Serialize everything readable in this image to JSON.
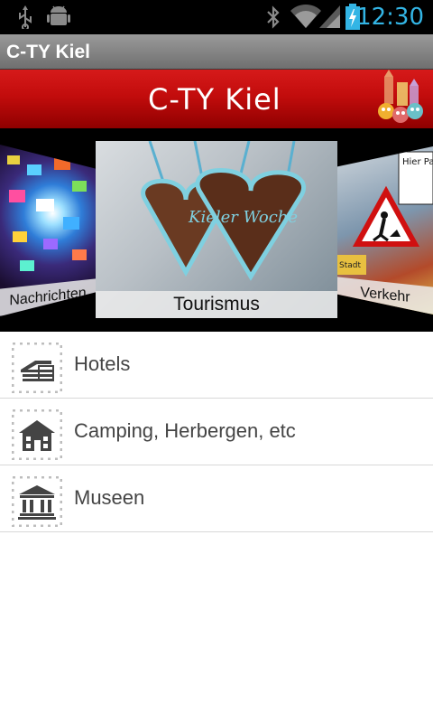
{
  "statusbar": {
    "icons": [
      "usb-icon",
      "android-debug-icon",
      "bluetooth-icon",
      "wifi-icon",
      "signal-icon",
      "battery-charging-icon"
    ],
    "time": "12:30"
  },
  "actionbar": {
    "title": "C-TY Kiel"
  },
  "banner": {
    "logo_text": "C-TY Kiel"
  },
  "carousel": {
    "panels": [
      {
        "label": "Nachrichten"
      },
      {
        "label": "Tourismus",
        "heart_text": "Kieler Woche"
      },
      {
        "label": "Verkehr",
        "sign_text": "Hier Parksch löse",
        "sign_text_small": "Stadt"
      }
    ]
  },
  "list": {
    "items": [
      {
        "label": "Hotels",
        "icon": "hotel-icon"
      },
      {
        "label": "Camping, Herbergen, etc",
        "icon": "house-icon"
      },
      {
        "label": "Museen",
        "icon": "museum-icon"
      }
    ]
  },
  "colors": {
    "accent": "#33b5e5",
    "banner_red": "#c20c0c",
    "icon_gray": "#444444"
  }
}
